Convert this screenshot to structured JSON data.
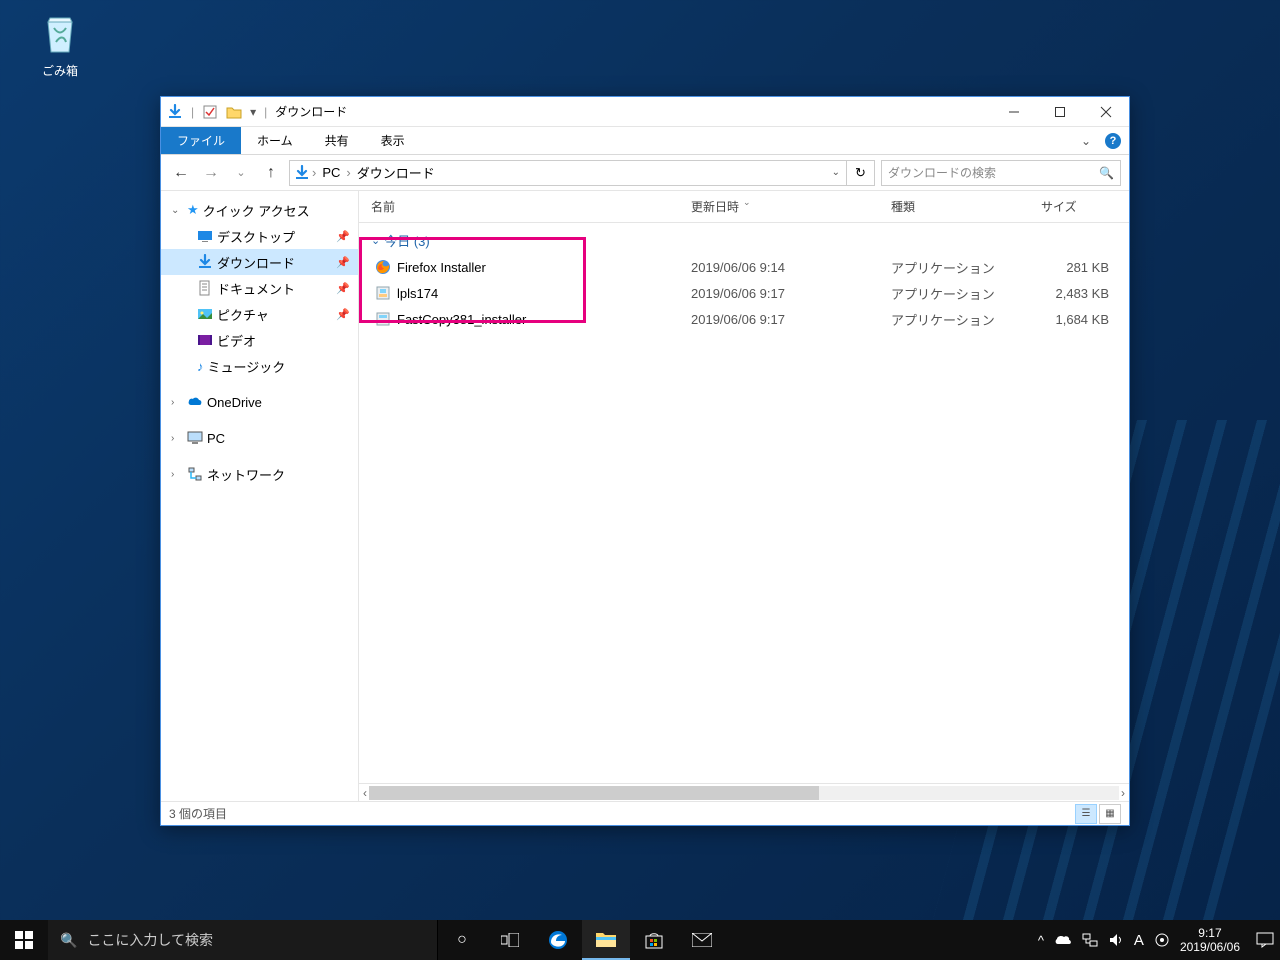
{
  "desktop": {
    "recycle_bin": "ごみ箱"
  },
  "window": {
    "title": "ダウンロード",
    "tabs": {
      "file": "ファイル",
      "home": "ホーム",
      "share": "共有",
      "view": "表示"
    },
    "breadcrumb": {
      "pc": "PC",
      "folder": "ダウンロード"
    },
    "search_placeholder": "ダウンロードの検索",
    "columns": {
      "name": "名前",
      "date": "更新日時",
      "type": "種類",
      "size": "サイズ"
    },
    "group_label": "今日 (3)",
    "files": [
      {
        "name": "Firefox Installer",
        "date": "2019/06/06 9:14",
        "type": "アプリケーション",
        "size": "281 KB"
      },
      {
        "name": "lpls174",
        "date": "2019/06/06 9:17",
        "type": "アプリケーション",
        "size": "2,483 KB"
      },
      {
        "name": "FastCopy381_installer",
        "date": "2019/06/06 9:17",
        "type": "アプリケーション",
        "size": "1,684 KB"
      }
    ],
    "status": "3 個の項目"
  },
  "sidebar": {
    "quick_access": "クイック アクセス",
    "desktop": "デスクトップ",
    "downloads": "ダウンロード",
    "documents": "ドキュメント",
    "pictures": "ピクチャ",
    "videos": "ビデオ",
    "music": "ミュージック",
    "onedrive": "OneDrive",
    "pc": "PC",
    "network": "ネットワーク"
  },
  "taskbar": {
    "search_placeholder": "ここに入力して検索",
    "time": "9:17",
    "date": "2019/06/06",
    "ime": "A"
  }
}
